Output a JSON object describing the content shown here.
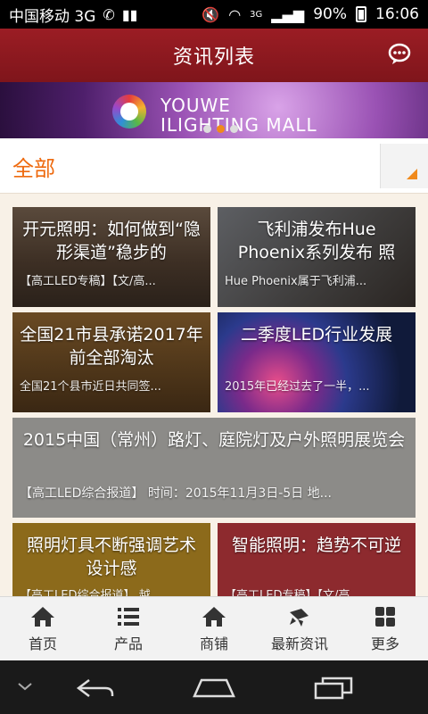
{
  "status_bar": {
    "carrier": "中国移动 3G",
    "network": "3G",
    "battery": "90%",
    "time": "16:06"
  },
  "header": {
    "title": "资讯列表",
    "chat_icon": "chat-bubble-icon"
  },
  "banner": {
    "brand_line1": "YOUWE",
    "brand_line2": "ILIGHTING MALL",
    "slide_count": 3,
    "active_slide": 1
  },
  "category": {
    "label": "全部",
    "dropdown_icon": "dropdown-triangle-icon"
  },
  "cards": [
    {
      "title": "开元照明：如何做到“隐形渠道”稳步的",
      "sub": "【高工LED专稿】【文/高..."
    },
    {
      "title": "飞利浦发布Hue Phoenix系列发布 照",
      "sub": "Hue Phoenix属于飞利浦..."
    },
    {
      "title": "全国21市县承诺2017年前全部淘汰",
      "sub": "全国21个县市近日共同签..."
    },
    {
      "title": "二季度LED行业发展",
      "sub": "2015年已经过去了一半，..."
    },
    {
      "title": "2015中国（常州）路灯、庭院灯及户外照明展览会",
      "sub": "【高工LED综合报道】 时间：2015年11月3日-5日        地..."
    },
    {
      "title": "照明灯具不断强调艺术设计感",
      "sub": "【高工LED综合报道】 越..."
    },
    {
      "title": "智能照明：趋势不可逆",
      "sub": "【高工LED专稿】【文/高..."
    }
  ],
  "tabs": [
    {
      "label": "首页",
      "icon": "home-icon"
    },
    {
      "label": "产品",
      "icon": "list-icon"
    },
    {
      "label": "商铺",
      "icon": "store-icon"
    },
    {
      "label": "最新资讯",
      "icon": "news-icon"
    },
    {
      "label": "更多",
      "icon": "grid-icon"
    }
  ],
  "colors": {
    "header": "#8b1a20",
    "accent": "#ee6a0f"
  }
}
